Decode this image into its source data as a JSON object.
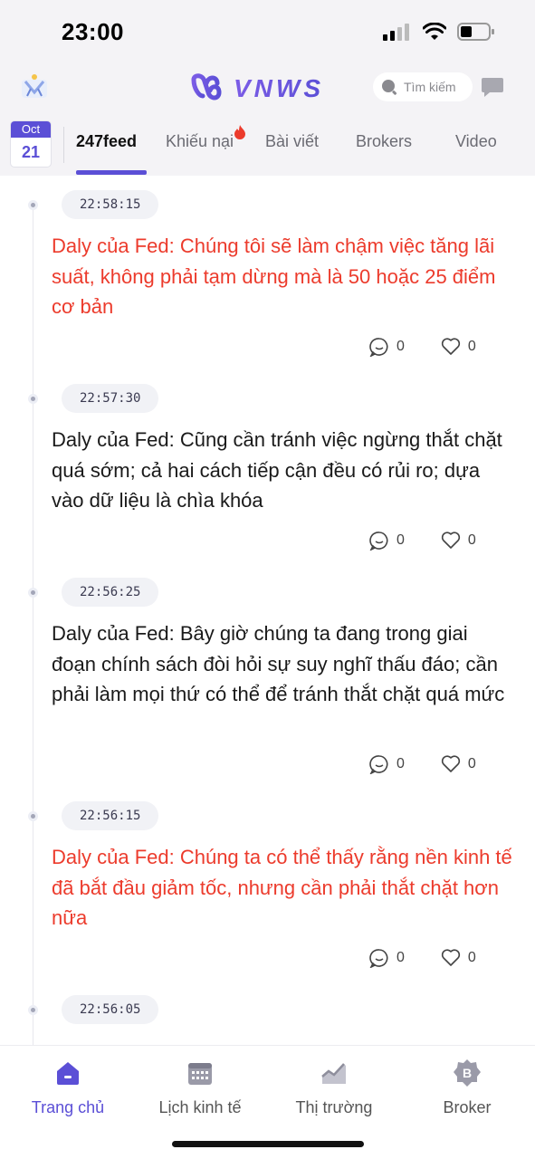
{
  "status_bar": {
    "time": "23:00"
  },
  "header": {
    "brand": "VNWS",
    "search_placeholder": "Tìm kiếm"
  },
  "date_badge": {
    "month": "Oct",
    "day": "21"
  },
  "tabs": [
    {
      "label": "247feed",
      "active": true
    },
    {
      "label": "Khiếu nại",
      "active": false,
      "badge": "fire-icon"
    },
    {
      "label": "Bài viết",
      "active": false
    },
    {
      "label": "Brokers",
      "active": false
    },
    {
      "label": "Video",
      "active": false
    }
  ],
  "feed": [
    {
      "time": "22:58:15",
      "text": "Daly của Fed: Chúng tôi sẽ làm chậm việc tăng lãi suất, không phải tạm dừng mà là 50 hoặc 25 điểm cơ bản",
      "highlight": true,
      "comments": "0",
      "likes": "0"
    },
    {
      "time": "22:57:30",
      "text": "Daly của Fed: Cũng cần tránh việc ngừng thắt chặt quá sớm; cả hai cách tiếp cận đều có rủi ro; dựa vào dữ liệu là chìa khóa",
      "highlight": false,
      "comments": "0",
      "likes": "0"
    },
    {
      "time": "22:56:25",
      "text": "Daly của Fed: Bây giờ chúng ta đang trong giai đoạn chính sách đòi hỏi sự suy nghĩ thấu đáo; cần phải làm mọi thứ có thể để tránh thắt chặt quá mức",
      "highlight": false,
      "comments": "0",
      "likes": "0"
    },
    {
      "time": "22:56:15",
      "text": "Daly của Fed: Chúng ta có thể thấy rằng nền kinh tế đã bắt đầu giảm tốc, nhưng cần phải thắt chặt hơn nữa",
      "highlight": true,
      "comments": "0",
      "likes": "0"
    },
    {
      "time": "22:56:05"
    }
  ],
  "bottom_nav": [
    {
      "label": "Trang chủ",
      "icon": "home-icon",
      "active": true
    },
    {
      "label": "Lịch kinh tế",
      "icon": "calendar-icon",
      "active": false
    },
    {
      "label": "Thị trường",
      "icon": "chart-icon",
      "active": false
    },
    {
      "label": "Broker",
      "icon": "broker-badge-icon",
      "active": false
    }
  ],
  "colors": {
    "accent": "#5b4fd6",
    "highlight_text": "#ec3b2c"
  }
}
